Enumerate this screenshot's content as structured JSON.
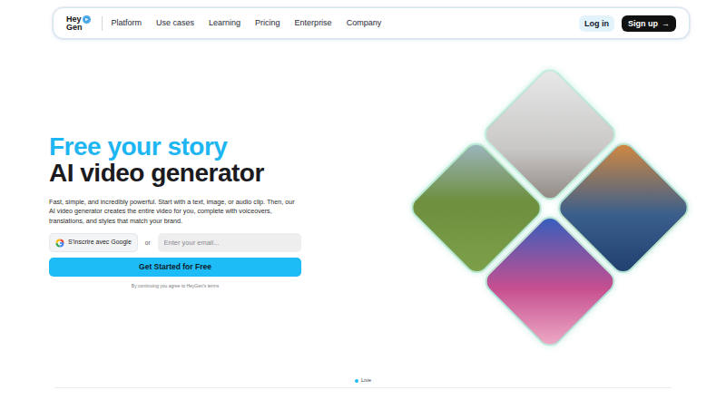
{
  "logo": {
    "lines": [
      "Hey",
      "Gen"
    ]
  },
  "nav": {
    "items": [
      "Platform",
      "Use cases",
      "Learning",
      "Pricing",
      "Enterprise",
      "Company"
    ],
    "login": "Log in",
    "signup": "Sign up",
    "signup_icon": "→"
  },
  "hero": {
    "title_accent": "Free your story",
    "title": "AI video generator",
    "description": "Fast, simple, and incredibly powerful. Start with a text, image, or audio clip. Then, our AI video generator creates the entire video for you, complete with voiceovers, translations, and styles that match your brand.",
    "google_button": "S'inscrire avec Google",
    "or": "or",
    "email_placeholder": "Enter your email...",
    "cta": "Get Started for Free",
    "terms": "By continuing you agree to HeyGen's terms"
  },
  "footer": {
    "live": "Live"
  }
}
